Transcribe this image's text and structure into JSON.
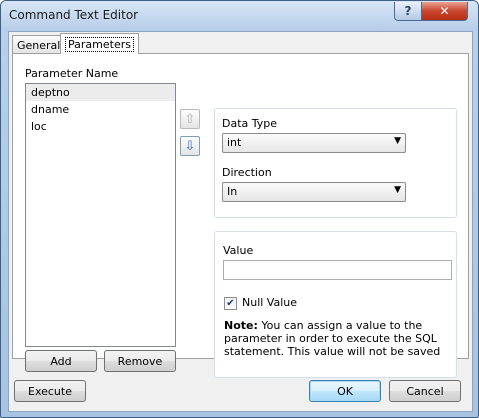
{
  "window": {
    "title": "Command Text Editor",
    "help_glyph": "?",
    "close_glyph": "✕"
  },
  "tabs": [
    {
      "label": "General"
    },
    {
      "label": "Parameters"
    }
  ],
  "parameters": {
    "list_label": "Parameter Name",
    "items": [
      "deptno",
      "dname",
      "loc"
    ],
    "selected_index": 0,
    "move_up_glyph": "⇧",
    "move_down_glyph": "⇩",
    "add_label": "Add",
    "remove_label": "Remove"
  },
  "properties": {
    "data_type_label": "Data Type",
    "data_type_value": "int",
    "direction_label": "Direction",
    "direction_value": "In",
    "value_label": "Value",
    "value_text": "",
    "null_value_label": "Null Value",
    "null_value_checked": true,
    "check_glyph": "✔",
    "combo_arrow": "▼",
    "note_label": "Note:",
    "note_text": "You can assign a value to the parameter in order to execute the SQL statement. This value will not be saved"
  },
  "footer": {
    "execute_label": "Execute",
    "ok_label": "OK",
    "cancel_label": "Cancel"
  },
  "colors": {
    "title_bar": "#b9d1ea",
    "close_button": "#c9462c",
    "selection": "#ececec",
    "down_arrow": "#2f67c4"
  }
}
